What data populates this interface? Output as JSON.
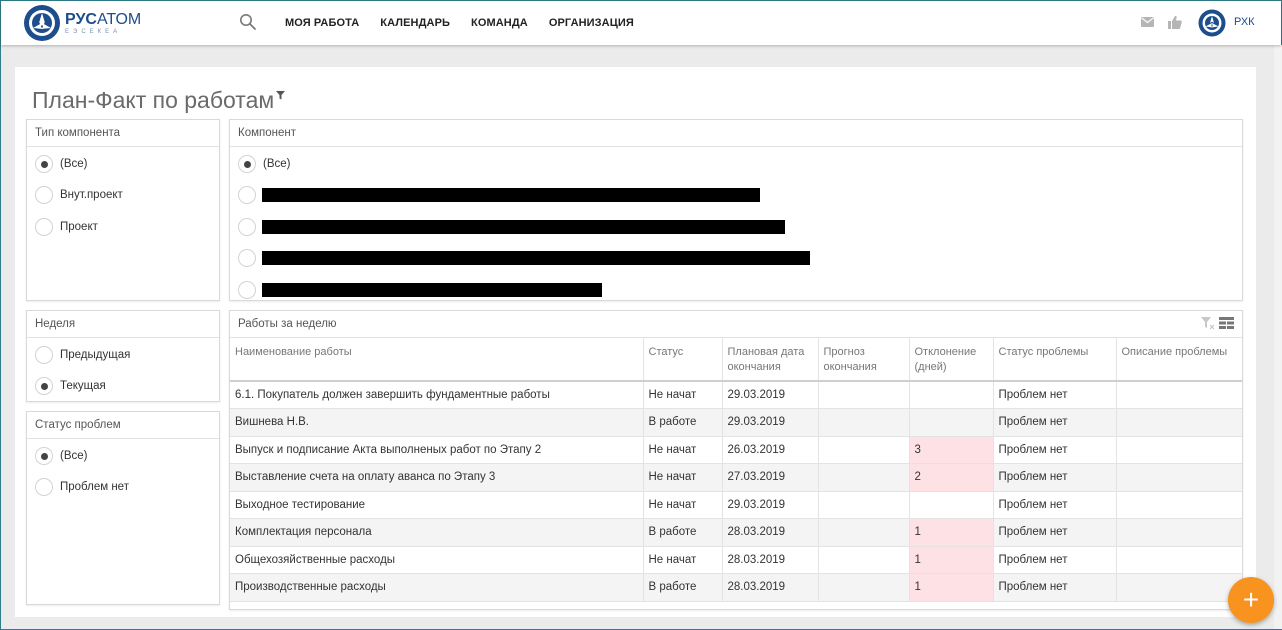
{
  "brand": {
    "name_bold": "РУС",
    "name_rest": "АТОМ",
    "sub": "ЕЭСЕКЕА"
  },
  "nav": [
    "МОЯ РАБОТА",
    "КАЛЕНДАРЬ",
    "КОМАНДА",
    "ОРГАНИЗАЦИЯ"
  ],
  "user": {
    "name": "РХК"
  },
  "page_title": "План-Факт по работам",
  "component_type": {
    "title": "Тип компонента",
    "options": [
      "(Все)",
      "Внут.проект",
      "Проект"
    ],
    "selected": 0
  },
  "component": {
    "title": "Компонент",
    "options": [
      "(Все)"
    ],
    "selected": 0,
    "redacted_rows": 4
  },
  "week": {
    "title": "Неделя",
    "options": [
      "Предыдущая",
      "Текущая"
    ],
    "selected": 1
  },
  "problem_status": {
    "title": "Статус проблем",
    "options": [
      "(Все)",
      "Проблем нет"
    ],
    "selected": 0
  },
  "works": {
    "title": "Работы за неделю",
    "columns": [
      "Наименование работы",
      "Статус",
      "Плановая дата окончания",
      "Прогноз окончания",
      "Отклонение (дней)",
      "Статус проблемы",
      "Описание проблемы"
    ],
    "rows": [
      [
        "6.1. Покупатель должен завершить фундаментные работы",
        "Не начат",
        "29.03.2019",
        "",
        "",
        "Проблем нет",
        ""
      ],
      [
        "Вишнева Н.В.",
        "В работе",
        "29.03.2019",
        "",
        "",
        "Проблем нет",
        ""
      ],
      [
        "Выпуск и подписание Акта выполненых работ по Этапу 2",
        "Не начат",
        "26.03.2019",
        "",
        "3",
        "Проблем нет",
        ""
      ],
      [
        "Выставление счета на оплату аванса по Этапу 3",
        "Не начат",
        "27.03.2019",
        "",
        "2",
        "Проблем нет",
        ""
      ],
      [
        "Выходное тестирование",
        "Не начат",
        "29.03.2019",
        "",
        "",
        "Проблем нет",
        ""
      ],
      [
        "Комплектация персонала",
        "В работе",
        "28.03.2019",
        "",
        "1",
        "Проблем нет",
        ""
      ],
      [
        "Общехозяйственные расходы",
        "Не начат",
        "28.03.2019",
        "",
        "1",
        "Проблем нет",
        ""
      ],
      [
        "Производственные расходы",
        "В работе",
        "28.03.2019",
        "",
        "1",
        "Проблем нет",
        ""
      ]
    ]
  },
  "colors": {
    "brand": "#1d4d8c",
    "fab": "#f7931e",
    "deviation_bg": "#fde1e4"
  },
  "icons": [
    "search-icon",
    "mail-icon",
    "thumbs-up-icon",
    "filter-icon",
    "clear-filter-icon",
    "table-layout-icon",
    "plus-icon"
  ]
}
